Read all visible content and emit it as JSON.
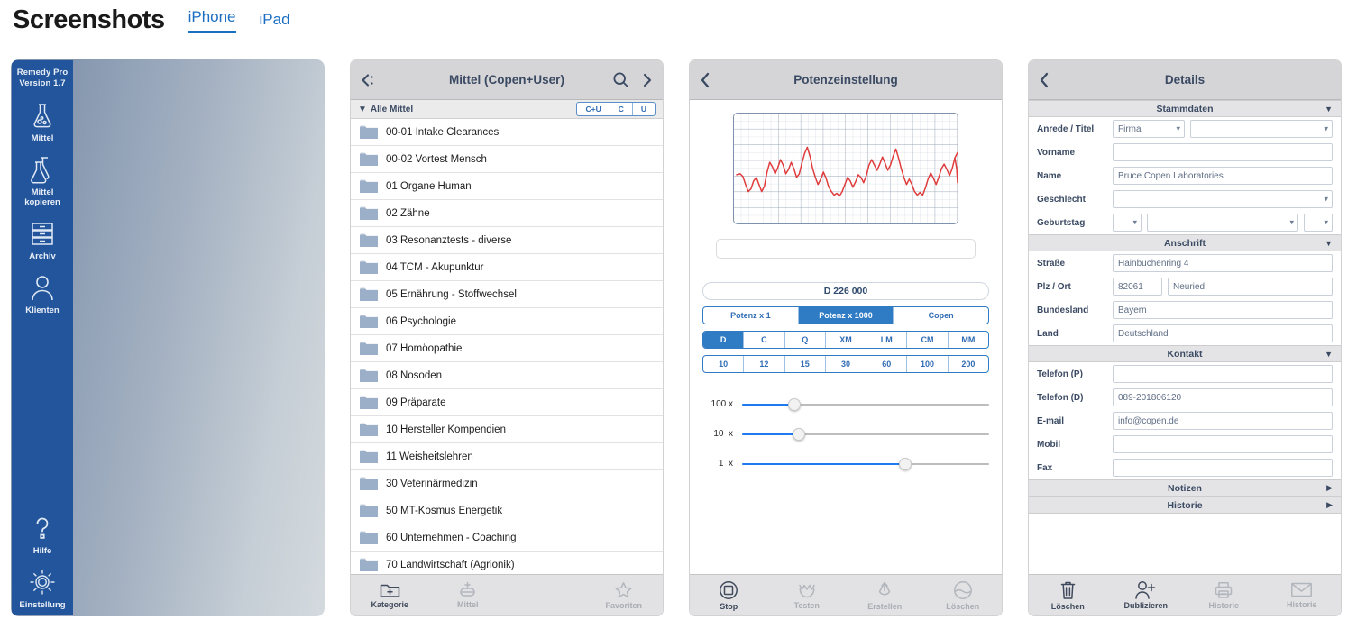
{
  "header": {
    "title": "Screenshots",
    "tabs": [
      {
        "label": "iPhone",
        "active": true
      },
      {
        "label": "iPad",
        "active": false
      }
    ]
  },
  "splash": {
    "version_line1": "Remedy Pro",
    "version_line2": "Version 1.7",
    "rail_items": [
      {
        "icon": "flask-icon",
        "label": "Mittel"
      },
      {
        "icon": "flask-copy-icon",
        "label": "Mittel\nkopieren"
      },
      {
        "icon": "archive-drawers-icon",
        "label": "Archiv"
      },
      {
        "icon": "person-icon",
        "label": "Klienten"
      }
    ],
    "rail_bottom_items": [
      {
        "icon": "question-mark-icon",
        "label": "Hilfe"
      },
      {
        "icon": "gear-icon",
        "label": "Einstellung"
      }
    ]
  },
  "list_panel": {
    "nav": {
      "back_icon": "back-list-icon",
      "title": "Mittel (Copen+User)",
      "search_icon": "search-icon",
      "forward_icon": "chevron-right-icon"
    },
    "filter_bar": {
      "group_label": "Alle Mittel",
      "disclosure_icon": "triangle-down-icon",
      "segments": [
        "C+U",
        "C",
        "U"
      ]
    },
    "rows": [
      "00-01 Intake Clearances",
      "00-02 Vortest Mensch",
      "01 Organe Human",
      "02 Zähne",
      "03 Resonanztests - diverse",
      "04 TCM - Akupunktur",
      "05 Ernährung - Stoffwechsel",
      "06 Psychologie",
      "07 Homöopathie",
      "08 Nosoden",
      "09 Präparate",
      "10 Hersteller Kompendien",
      "11 Weisheitslehren",
      "30 Veterinärmedizin",
      "50 MT-Kosmus Energetik",
      "60 Unternehmen - Coaching",
      "70 Landwirtschaft (Agrionik)"
    ],
    "tabs": [
      {
        "label": "Kategorie",
        "icon": "folder-plus-icon",
        "enabled": true
      },
      {
        "label": "Mittel",
        "icon": "capsule-plus-icon",
        "enabled": false
      },
      {
        "label": "Favoriten",
        "icon": "star-icon",
        "enabled": false
      }
    ]
  },
  "potency_panel": {
    "nav": {
      "back_icon": "chevron-left-icon",
      "title": "Potenzeinstellung"
    },
    "value_field": "D 226 000",
    "empty_field_value": "",
    "scale_segments": [
      {
        "label": "Potenz x 1",
        "selected": false
      },
      {
        "label": "Potenz x 1000",
        "selected": true
      },
      {
        "label": "Copen",
        "selected": false
      }
    ],
    "type_segments": [
      {
        "label": "D",
        "selected": true
      },
      {
        "label": "C",
        "selected": false
      },
      {
        "label": "Q",
        "selected": false
      },
      {
        "label": "XM",
        "selected": false
      },
      {
        "label": "LM",
        "selected": false
      },
      {
        "label": "CM",
        "selected": false
      },
      {
        "label": "MM",
        "selected": false
      }
    ],
    "number_segments": [
      {
        "label": "10",
        "selected": false
      },
      {
        "label": "12",
        "selected": false
      },
      {
        "label": "15",
        "selected": false
      },
      {
        "label": "30",
        "selected": false
      },
      {
        "label": "60",
        "selected": false
      },
      {
        "label": "100",
        "selected": false
      },
      {
        "label": "200",
        "selected": false
      }
    ],
    "sliders": [
      {
        "label": "100 x",
        "percent": 21
      },
      {
        "label": "10  x",
        "percent": 23
      },
      {
        "label": "1  x",
        "percent": 66
      }
    ],
    "tabs": [
      {
        "label": "Stop",
        "icon": "stop-square-icon",
        "enabled": true
      },
      {
        "label": "Testen",
        "icon": "crown-icon",
        "enabled": false
      },
      {
        "label": "Erstellen",
        "icon": "upload-drop-icon",
        "enabled": false
      },
      {
        "label": "Löschen",
        "icon": "circle-slash-icon",
        "enabled": false
      }
    ]
  },
  "details_panel": {
    "nav": {
      "back_icon": "chevron-left-icon",
      "title": "Details"
    },
    "sections": [
      {
        "title": "Stammdaten",
        "arrow_icon": "triangle-down-icon",
        "expanded": true,
        "rows": [
          {
            "label": "Anrede / Titel",
            "fields": [
              {
                "kind": "select",
                "value": "Firma",
                "width": "w-anrede"
              },
              {
                "kind": "select",
                "value": ""
              }
            ]
          },
          {
            "label": "Vorname",
            "fields": [
              {
                "kind": "text",
                "value": ""
              }
            ]
          },
          {
            "label": "Name",
            "fields": [
              {
                "kind": "text",
                "value": "Bruce Copen Laboratories"
              }
            ]
          },
          {
            "label": "Geschlecht",
            "fields": [
              {
                "kind": "select",
                "value": ""
              }
            ]
          },
          {
            "label": "Geburtstag",
            "fields": [
              {
                "kind": "select",
                "value": "",
                "width": "w-day"
              },
              {
                "kind": "select",
                "value": ""
              },
              {
                "kind": "select",
                "value": "",
                "width": "w-yr"
              }
            ]
          }
        ]
      },
      {
        "title": "Anschrift",
        "arrow_icon": "triangle-down-icon",
        "expanded": true,
        "rows": [
          {
            "label": "Straße",
            "fields": [
              {
                "kind": "text",
                "value": "Hainbuchenring 4"
              }
            ]
          },
          {
            "label": "Plz / Ort",
            "fields": [
              {
                "kind": "text",
                "value": "82061",
                "width": "w-plz"
              },
              {
                "kind": "text",
                "value": "Neuried"
              }
            ]
          },
          {
            "label": "Bundesland",
            "fields": [
              {
                "kind": "text",
                "value": "Bayern"
              }
            ]
          },
          {
            "label": "Land",
            "fields": [
              {
                "kind": "text",
                "value": "Deutschland"
              }
            ]
          }
        ]
      },
      {
        "title": "Kontakt",
        "arrow_icon": "triangle-down-icon",
        "expanded": true,
        "rows": [
          {
            "label": "Telefon (P)",
            "fields": [
              {
                "kind": "text",
                "value": ""
              }
            ]
          },
          {
            "label": "Telefon (D)",
            "fields": [
              {
                "kind": "text",
                "value": "089-201806120"
              }
            ]
          },
          {
            "label": "E-mail",
            "fields": [
              {
                "kind": "text",
                "value": "info@copen.de"
              }
            ]
          },
          {
            "label": "Mobil",
            "fields": [
              {
                "kind": "text",
                "value": ""
              }
            ]
          },
          {
            "label": "Fax",
            "fields": [
              {
                "kind": "text",
                "value": ""
              }
            ]
          }
        ]
      },
      {
        "title": "Notizen",
        "arrow_icon": "triangle-right-icon",
        "expanded": false,
        "rows": []
      },
      {
        "title": "Historie",
        "arrow_icon": "triangle-right-icon",
        "expanded": false,
        "rows": []
      }
    ],
    "tabs": [
      {
        "label": "Löschen",
        "icon": "trash-icon",
        "enabled": true
      },
      {
        "label": "Dublizieren",
        "icon": "person-plus-icon",
        "enabled": true
      },
      {
        "label": "Historie",
        "icon": "printer-icon",
        "enabled": false
      },
      {
        "label": "Historie",
        "icon": "envelope-icon",
        "enabled": false
      }
    ]
  },
  "colors": {
    "accent_blue": "#1b6ec2",
    "rail_blue": "#22559b",
    "segment_blue": "#2f7bc4",
    "waveform_red": "#e03b3b",
    "nav_grey": "#d5d5d7"
  }
}
